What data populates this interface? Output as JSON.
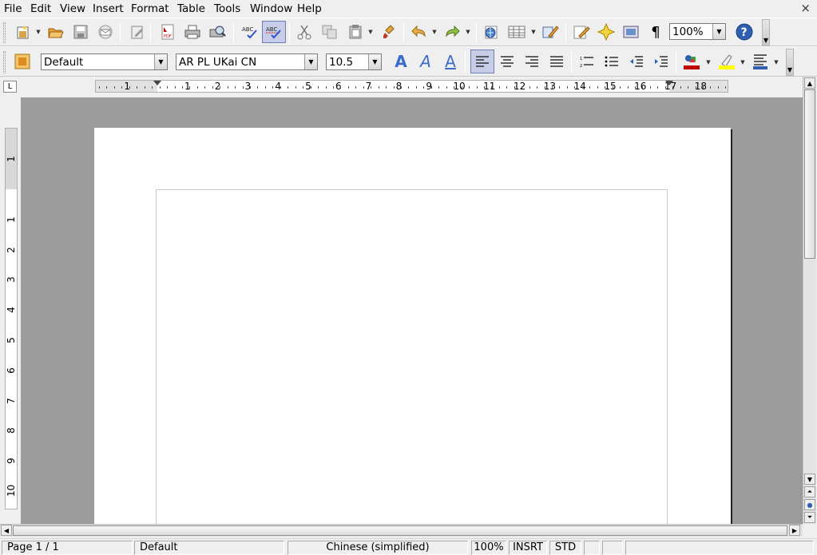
{
  "menu": {
    "file": {
      "label": "File"
    },
    "edit": {
      "label": "Edit"
    },
    "view": {
      "label": "View"
    },
    "insert": {
      "label": "Insert"
    },
    "format": {
      "label": "Format"
    },
    "table": {
      "label": "Table"
    },
    "tools": {
      "label": "Tools"
    },
    "window": {
      "label": "Window"
    },
    "help": {
      "label": "Help"
    },
    "close_glyph": "×"
  },
  "standard_toolbar": {
    "zoom_value": "100%",
    "icons": [
      "new-icon",
      "open-icon",
      "save-icon",
      "email-icon",
      "edit-file-icon",
      "export-pdf-icon",
      "print-icon",
      "page-preview-icon",
      "spellcheck-icon",
      "autospellcheck-icon",
      "cut-icon",
      "copy-icon",
      "paste-icon",
      "format-paintbrush-icon",
      "undo-icon",
      "redo-icon",
      "hyperlink-icon",
      "table-icon",
      "draw-functions-icon",
      "find-replace-icon",
      "navigator-icon",
      "gallery-icon",
      "formatting-marks-icon",
      "help-icon"
    ],
    "formatting_marks_glyph": "¶",
    "help_glyph": "?"
  },
  "formatting_toolbar": {
    "paragraph_style": "Default",
    "font_name": "AR PL UKai CN",
    "font_size": "10.5",
    "bold_glyph": "A",
    "italic_glyph": "A",
    "underline_glyph": "A"
  },
  "rulers": {
    "horizontal_ticks": [
      "1",
      "1",
      "2",
      "3",
      "4",
      "5",
      "6",
      "7",
      "8",
      "9",
      "10",
      "11",
      "12",
      "13",
      "14",
      "15",
      "16",
      "17",
      "18"
    ],
    "vertical_ticks": [
      "1",
      "1",
      "2",
      "3",
      "4",
      "5",
      "6",
      "7",
      "8",
      "9",
      "10"
    ]
  },
  "statusbar": {
    "page": "Page 1 / 1",
    "page_style": "Default",
    "language": "Chinese (simplified)",
    "zoom": "100%",
    "insert_mode": "INSRT",
    "selection_mode": "STD"
  },
  "colors": {
    "workspace_bg": "#9c9c9c",
    "page_bg": "#ffffff",
    "active_button": "#c7cde6",
    "font_color": "#c00000",
    "highlight": "#ffff00"
  }
}
